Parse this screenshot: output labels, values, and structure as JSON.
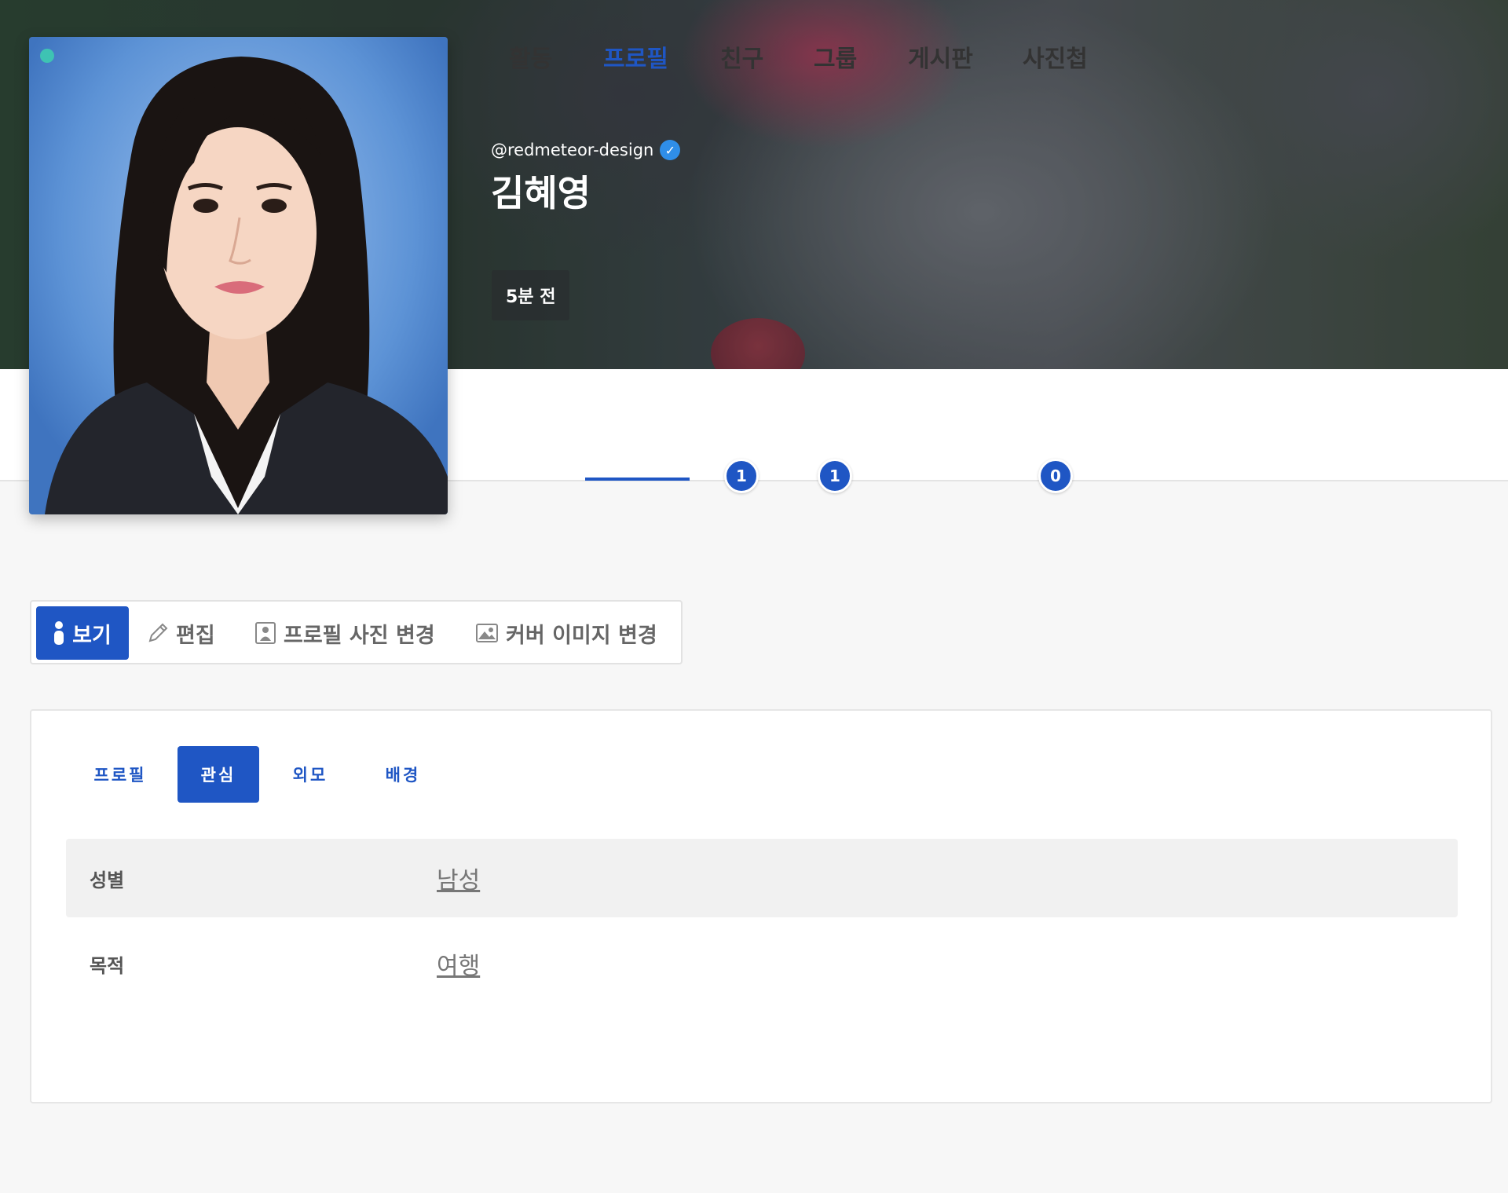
{
  "profile": {
    "handle": "@redmeteor-design",
    "name": "김혜영",
    "last_seen": "5분 전",
    "online_color": "#3ec3b3",
    "verified_icon": "check-circle-icon"
  },
  "nav": {
    "tabs": [
      {
        "label": "활동"
      },
      {
        "label": "프로필",
        "active": true
      },
      {
        "label": "친구",
        "count": "1"
      },
      {
        "label": "그룹",
        "count": "1"
      },
      {
        "label": "게시판"
      },
      {
        "label": "사진첩",
        "count": "0"
      }
    ]
  },
  "actions": {
    "view": {
      "label": "보기",
      "icon": "info-icon"
    },
    "edit": {
      "label": "편집",
      "icon": "pencil-icon"
    },
    "change_photo": {
      "label": "프로필 사진 변경",
      "icon": "portrait-icon"
    },
    "change_cover": {
      "label": "커버 이미지 변경",
      "icon": "image-icon"
    }
  },
  "panel": {
    "tabs": [
      {
        "label": "프로필"
      },
      {
        "label": "관심",
        "active": true
      },
      {
        "label": "외모"
      },
      {
        "label": "배경"
      }
    ],
    "fields": [
      {
        "label": "성별",
        "value": "남성"
      },
      {
        "label": "목적",
        "value": "여행"
      }
    ]
  },
  "colors": {
    "accent": "#1f56c4",
    "verified": "#2f8ee8"
  }
}
